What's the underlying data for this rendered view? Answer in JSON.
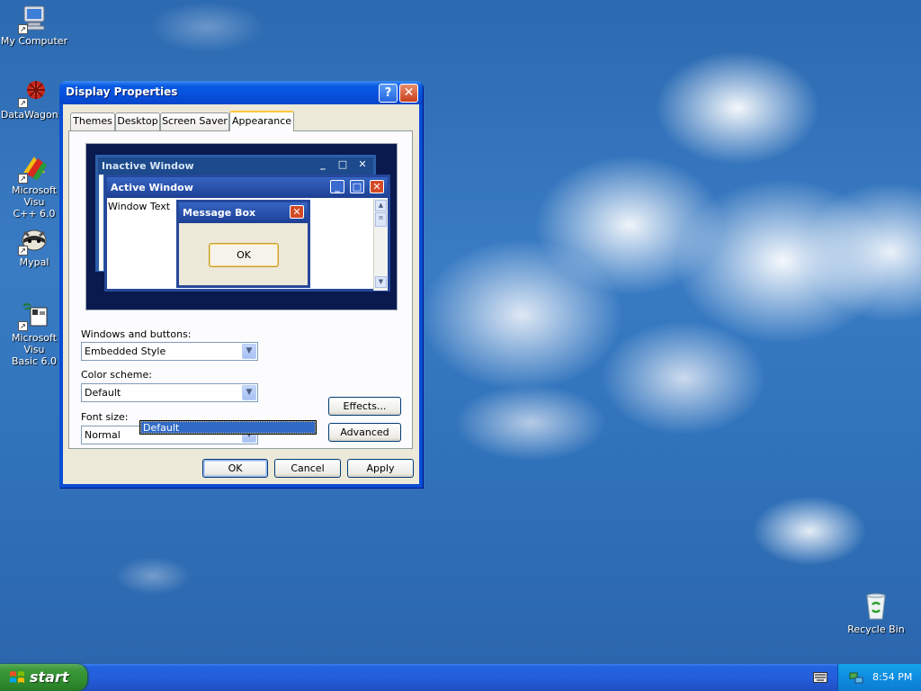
{
  "desktop": {
    "icons": [
      {
        "label": "My Computer",
        "icon": "my-computer-icon"
      },
      {
        "label": "DataWagon...",
        "icon": "datawagon-icon"
      },
      {
        "label": "Microsoft Visu\nC++ 6.0",
        "icon": "visual-cpp-icon"
      },
      {
        "label": "Mypal",
        "icon": "mypal-icon"
      },
      {
        "label": "Microsoft Visu\nBasic 6.0",
        "icon": "visual-basic-icon"
      },
      {
        "label": "Recycle Bin",
        "icon": "recycle-bin-icon"
      }
    ]
  },
  "window": {
    "title": "Display Properties",
    "help_label": "?",
    "close_label": "✕",
    "tabs": [
      {
        "label": "Themes"
      },
      {
        "label": "Desktop"
      },
      {
        "label": "Screen Saver"
      },
      {
        "label": "Appearance",
        "active": true
      }
    ],
    "preview": {
      "inactive_title": "Inactive Window",
      "active_title": "Active Window",
      "window_text": "Window Text",
      "message_title": "Message Box",
      "ok_label": "OK"
    },
    "windows_and_buttons": {
      "label": "Windows and buttons:",
      "value": "Embedded Style"
    },
    "color_scheme": {
      "label": "Color scheme:",
      "value": "Default",
      "dropdown_option": "Default"
    },
    "font_size": {
      "label": "Font size:",
      "value": "Normal"
    },
    "effects_label": "Effects...",
    "advanced_label": "Advanced",
    "ok_label": "OK",
    "cancel_label": "Cancel",
    "apply_label": "Apply"
  },
  "taskbar": {
    "start_label": "start",
    "clock": "8:54 PM"
  },
  "colors": {
    "title_bar": "#0a5ce4",
    "start_green": "#3c9a3a",
    "dialog_face": "#ece9d8",
    "selection": "#316ac5"
  }
}
